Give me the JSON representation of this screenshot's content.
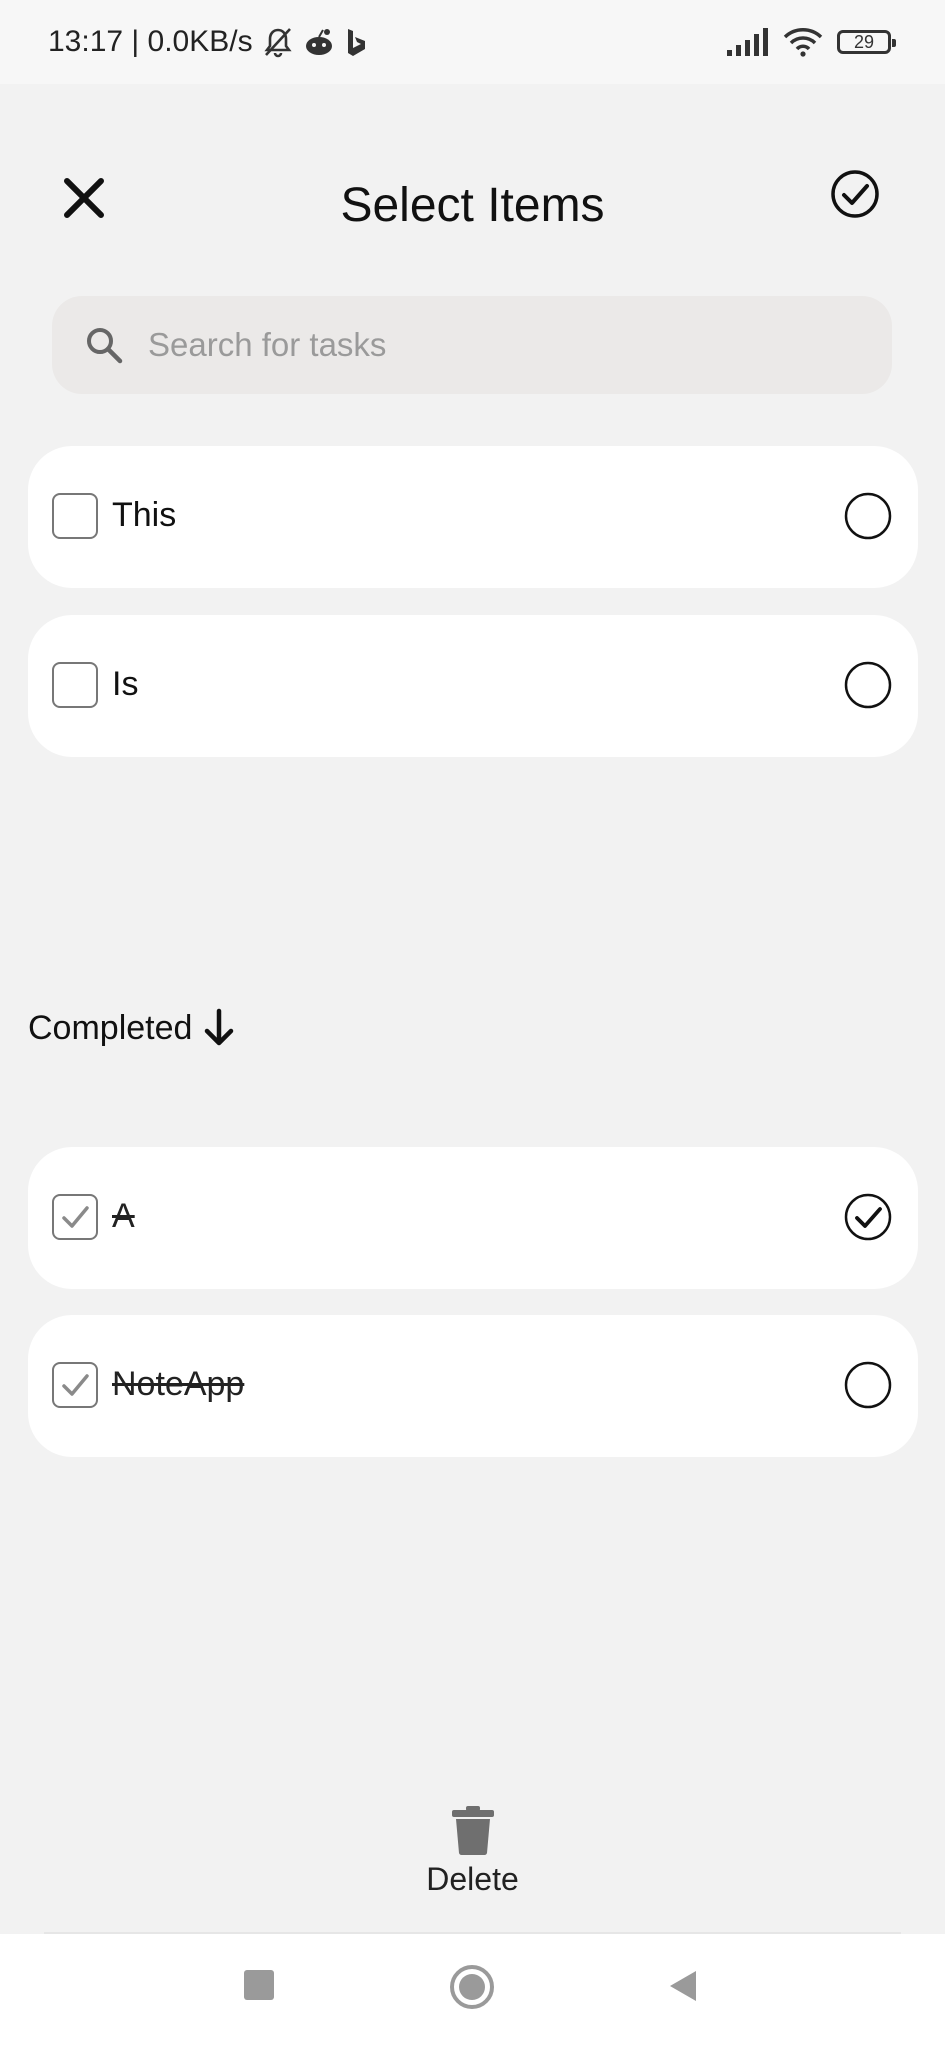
{
  "status_bar": {
    "time_speed": "13:17 | 0.0KB/s",
    "battery": "29",
    "icons": [
      "bell-off-icon",
      "reddit-icon",
      "bing-icon",
      "signal-icon",
      "wifi-icon",
      "battery-icon"
    ]
  },
  "header": {
    "title": "Select Items",
    "close_icon": "close-icon",
    "confirm_icon": "check-circle-icon"
  },
  "search": {
    "placeholder": "Search for tasks",
    "value": ""
  },
  "tasks": [
    {
      "label": "This",
      "checked": false,
      "selected": false
    },
    {
      "label": "Is",
      "checked": false,
      "selected": false
    }
  ],
  "completed": {
    "label": "Completed",
    "icon": "arrow-down-icon"
  },
  "completed_tasks": [
    {
      "label": "A",
      "checked": true,
      "selected": true
    },
    {
      "label": "NoteApp",
      "checked": true,
      "selected": false
    }
  ],
  "actions": {
    "delete_label": "Delete"
  },
  "colors": {
    "background": "#f2f2f2",
    "card": "#ffffff",
    "search_bg": "#ebe9e8",
    "checkbox_border": "#777777",
    "text": "#111111"
  }
}
